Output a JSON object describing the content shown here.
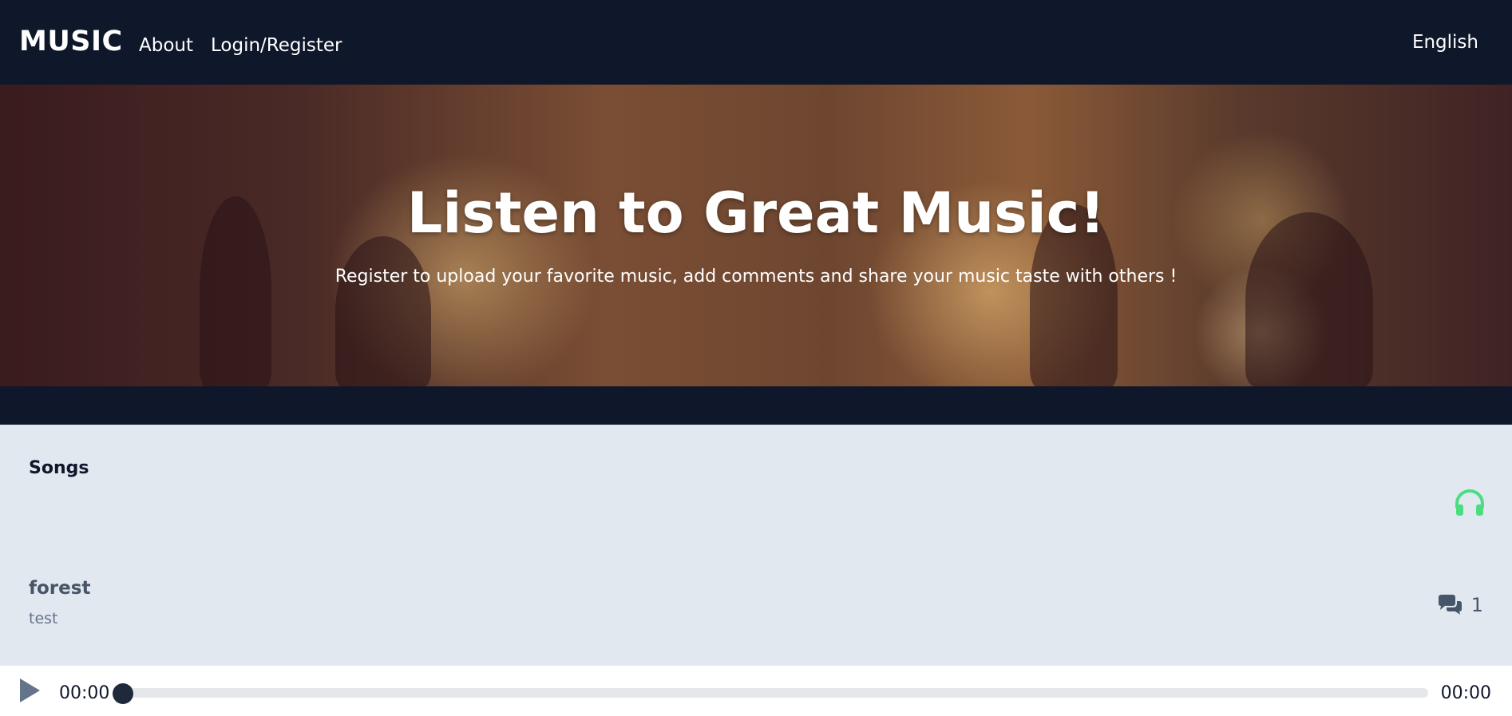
{
  "nav": {
    "brand": "MUSIC",
    "about": "About",
    "login": "Login/Register",
    "language": "English"
  },
  "hero": {
    "title": "Listen to Great Music!",
    "subtitle": "Register to upload your favorite music, add comments and share your music taste with others !"
  },
  "songs": {
    "heading": "Songs",
    "headphones_icon": "headphones-icon",
    "items": [
      {
        "title": "forest",
        "description": "test",
        "comments": "1"
      }
    ]
  },
  "player": {
    "current_time": "00:00",
    "duration": "00:00",
    "progress": 0
  },
  "colors": {
    "navbar": "#0f172a",
    "background": "#e2e8f0",
    "accent": "#4ade80"
  }
}
